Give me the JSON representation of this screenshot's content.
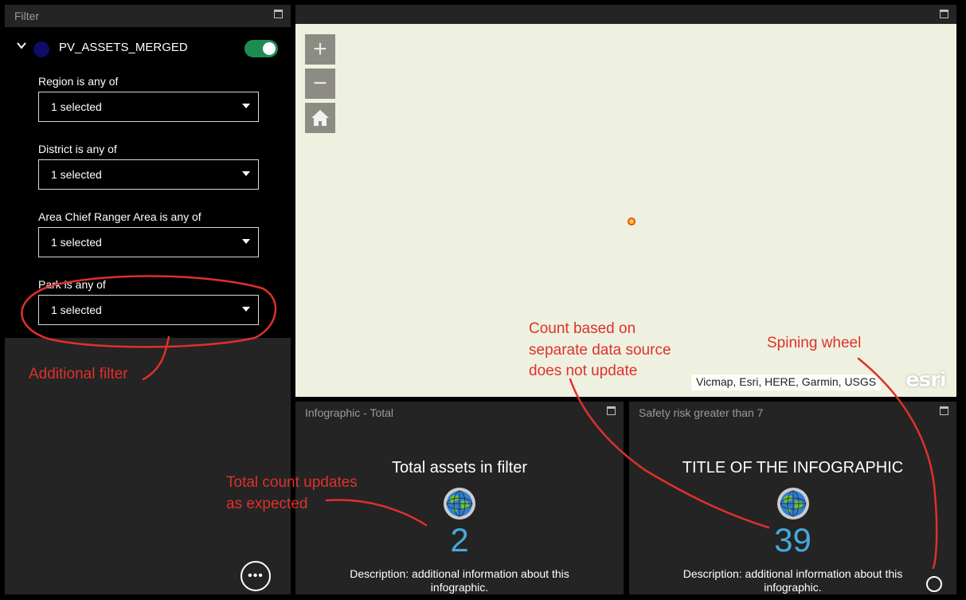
{
  "filter_panel": {
    "title": "Filter",
    "layer_name": "PV_ASSETS_MERGED",
    "filters": [
      {
        "label": "Region is any of",
        "value": "1 selected"
      },
      {
        "label": "District is any of",
        "value": "1 selected"
      },
      {
        "label": "Area Chief Ranger Area is any of",
        "value": "1 selected"
      },
      {
        "label": "Park is any of",
        "value": "1 selected"
      }
    ],
    "more_label": "•••"
  },
  "map": {
    "attribution": "Vicmap, Esri, HERE, Garmin, USGS",
    "logo_text": "esri",
    "zoom_in": "+",
    "zoom_out": "−"
  },
  "infographic_total": {
    "panel_title": "Infographic - Total",
    "title": "Total assets in filter",
    "value": "2",
    "description": "Description: additional information about this infographic."
  },
  "infographic_safety": {
    "panel_title": "Safety risk greater than 7",
    "title": "TITLE OF THE INFOGRAPHIC",
    "value": "39",
    "description": "Description: additional information about this infographic."
  },
  "annotations": {
    "additional_filter": "Additional filter",
    "total_count_line1": "Total count updates",
    "total_count_line2": "as expected",
    "separate_line1": "Count based on",
    "separate_line2": "separate data source",
    "separate_line3": "does not update",
    "spinning": "Spining wheel",
    "color": "#e0302c"
  },
  "colors": {
    "toggle_on": "#1e8c52",
    "value_blue": "#46a9d8",
    "panel_bg": "#242424",
    "map_bg": "#eef1df"
  }
}
